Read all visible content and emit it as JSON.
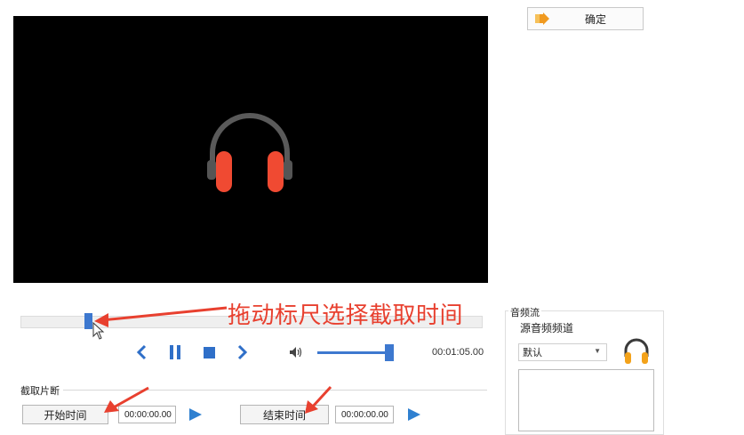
{
  "toolbar": {
    "ok_label": "确定"
  },
  "player": {
    "time": "00:01:05.00",
    "progress_fraction": 0.15,
    "volume_fraction": 0.95
  },
  "annotation": {
    "text": "拖动标尺选择截取时间",
    "color": "#e8402f"
  },
  "fragment": {
    "title": "截取片断",
    "start_label": "开始时间",
    "start_value": "00:00:00.00",
    "end_label": "结束时间",
    "end_value": "00:00:00.00"
  },
  "audio": {
    "title": "音频流",
    "subtitle": "源音频频道",
    "selected": "默认"
  },
  "colors": {
    "accent": "#3d78cf",
    "headphone_red": "#f04a32",
    "annotation_red": "#e8402f"
  }
}
